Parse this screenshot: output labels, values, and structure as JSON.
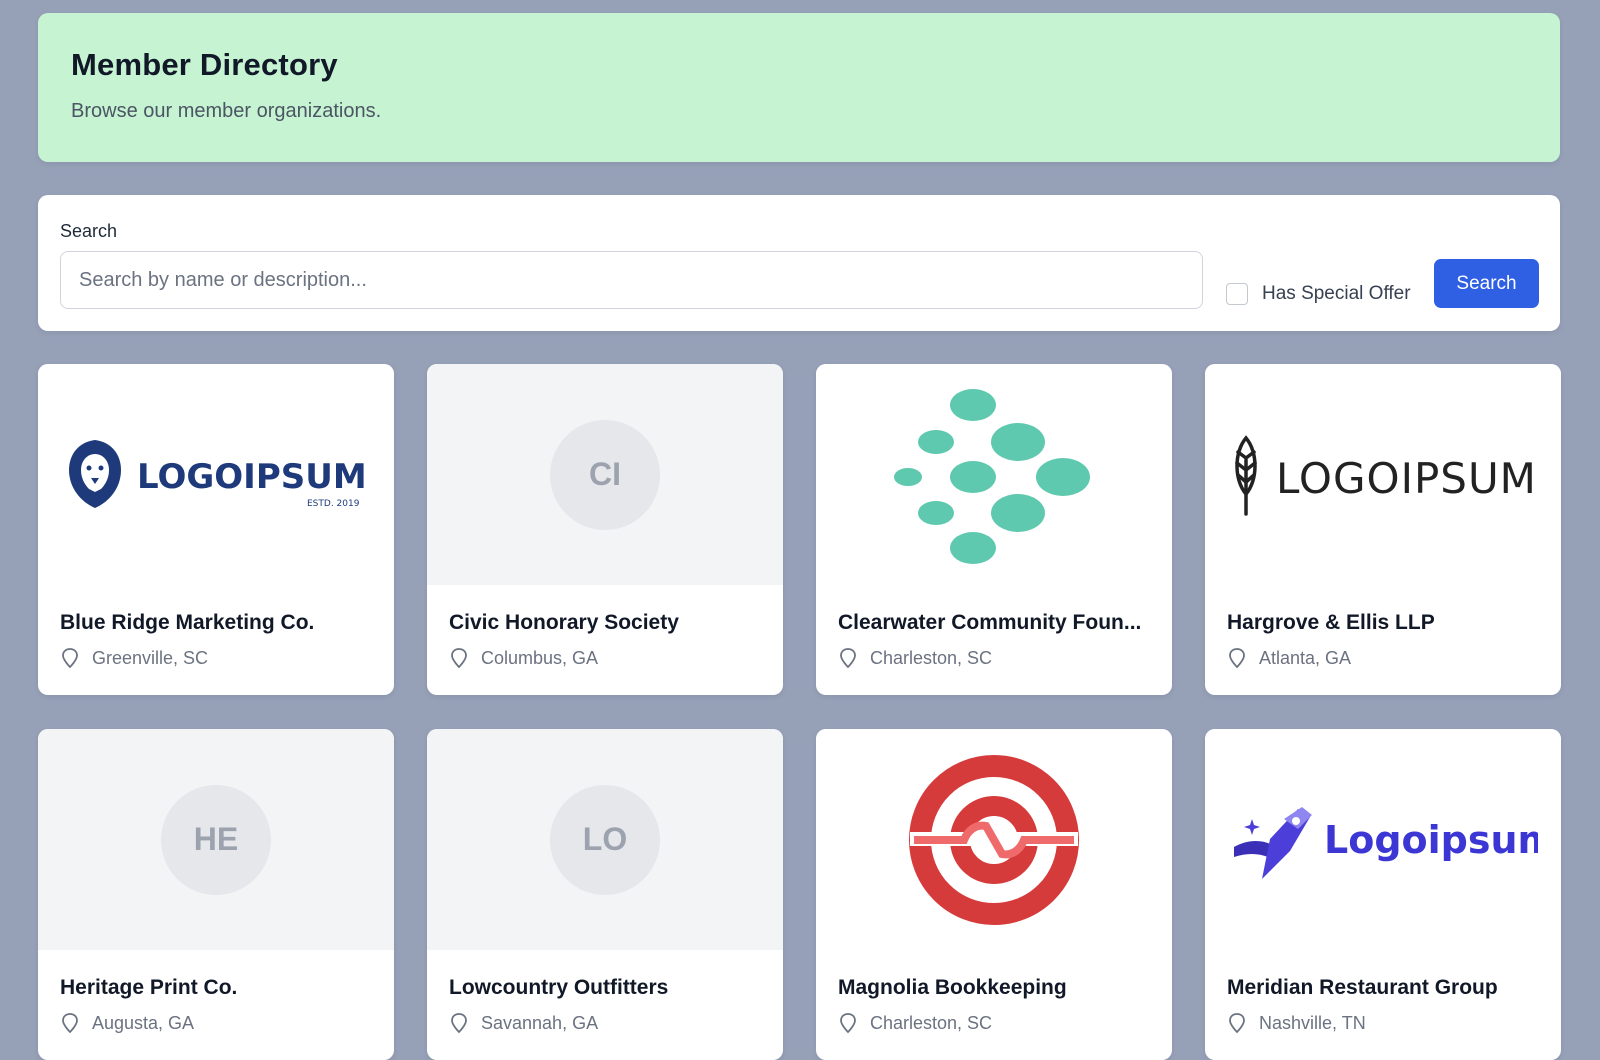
{
  "header": {
    "title": "Member Directory",
    "subtitle": "Browse our member organizations."
  },
  "search": {
    "label": "Search",
    "placeholder": "Search by name or description...",
    "value": "",
    "special_offer_label": "Has Special Offer",
    "special_offer_checked": false,
    "button_label": "Search"
  },
  "colors": {
    "header_bg": "#c6f4d3",
    "page_bg": "#96a1b8",
    "accent": "#2f5fe3"
  },
  "members": [
    {
      "name": "Blue Ridge Marketing Co.",
      "location": "Greenville, SC",
      "logo": "lion-logo",
      "logo_text": "LOGOIPSUM",
      "logo_subtext": "ESTD. 2019"
    },
    {
      "name": "Civic Honorary Society",
      "location": "Columbus, GA",
      "initials": "CI"
    },
    {
      "name": "Clearwater Community Foun...",
      "location": "Charleston, SC",
      "logo": "dots-logo"
    },
    {
      "name": "Hargrove & Ellis LLP",
      "location": "Atlanta, GA",
      "logo": "feather-logo",
      "logo_text": "LOGOIPSUM"
    },
    {
      "name": "Heritage Print Co.",
      "location": "Augusta, GA",
      "initials": "HE"
    },
    {
      "name": "Lowcountry Outfitters",
      "location": "Savannah, GA",
      "initials": "LO"
    },
    {
      "name": "Magnolia Bookkeeping",
      "location": "Charleston, SC",
      "logo": "red-swirl-logo"
    },
    {
      "name": "Meridian Restaurant Group",
      "location": "Nashville, TN",
      "logo": "rocket-logo",
      "logo_text": "Logoipsum"
    }
  ]
}
